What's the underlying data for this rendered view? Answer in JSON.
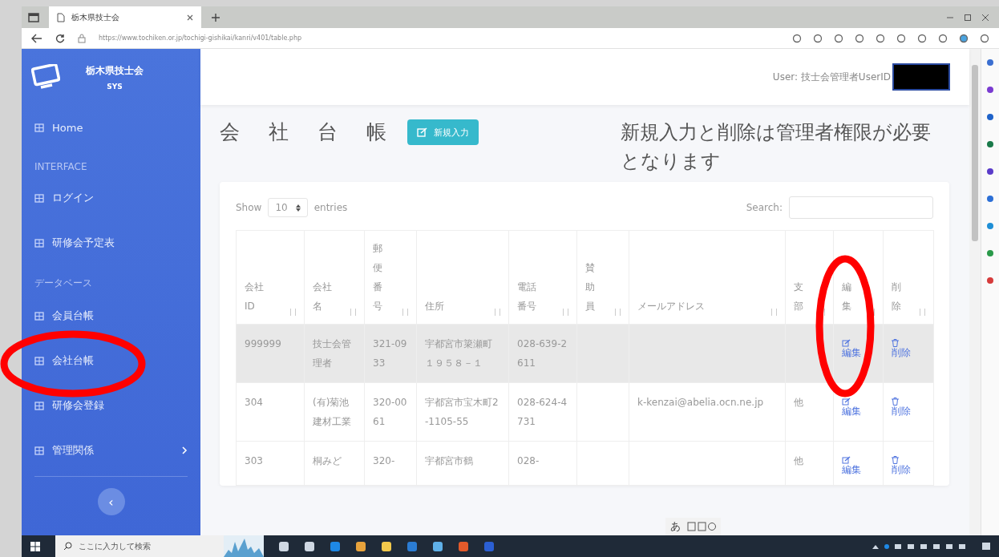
{
  "browser": {
    "tab_title": "栃木県技士会",
    "url": "https://www.tochiken.or.jp/tochigi-gishikai/kanri/v401/table.php"
  },
  "sidebar": {
    "brand": "栃木県技士会",
    "brand_sub": "SYS",
    "collapse_button": "‹",
    "items": [
      {
        "kind": "item",
        "label": "Home",
        "has_submenu": false
      },
      {
        "kind": "heading",
        "label": "INTERFACE"
      },
      {
        "kind": "item",
        "label": "ログイン",
        "has_submenu": false
      },
      {
        "kind": "item",
        "label": "研修会予定表",
        "has_submenu": false
      },
      {
        "kind": "heading",
        "label": "データベース"
      },
      {
        "kind": "item",
        "label": "会員台帳",
        "has_submenu": false
      },
      {
        "kind": "item",
        "label": "会社台帳",
        "has_submenu": false
      },
      {
        "kind": "item",
        "label": "研修会登録",
        "has_submenu": false
      },
      {
        "kind": "item",
        "label": "管理関係",
        "has_submenu": true
      }
    ]
  },
  "header": {
    "user_label": "User: 技士会管理者UserID"
  },
  "page": {
    "title": "会 社 台 帳",
    "new_button": "新規入力",
    "notice": "新規入力と削除は管理者権限が必要となります"
  },
  "table_controls": {
    "show": "Show",
    "page_size": "10",
    "entries": "entries",
    "search_label": "Search:"
  },
  "table": {
    "columns": [
      "会社ID",
      "会社名",
      "郵便番号",
      "住所",
      "電話番号",
      "賛助員",
      "メールアドレス",
      "支部",
      "編集",
      "削除"
    ],
    "rows": [
      {
        "highlighted": true,
        "cells": [
          "999999",
          "技士会管理者",
          "321-0933",
          "宇都宮市簗瀬町１９５８－１",
          "028-639-2611",
          "",
          "",
          ""
        ],
        "edit": "編集",
        "delete": "削除"
      },
      {
        "highlighted": false,
        "cells": [
          "304",
          "(有)菊池建材工業",
          "320-0061",
          "宇都宮市宝木町2-1105-55",
          "028-624-4731",
          "",
          "k-kenzai@abelia.ocn.ne.jp",
          "他"
        ],
        "edit": "編集",
        "delete": "削除"
      },
      {
        "highlighted": false,
        "cells": [
          "303",
          "桐みど",
          "320-",
          "宇都宮市鶴",
          "028-",
          "",
          "",
          "他"
        ],
        "edit": "編集",
        "delete": "削除"
      }
    ]
  },
  "ime_toolbar": {
    "mode": "あ"
  },
  "taskbar": {
    "search_placeholder": "ここに入力して検索"
  }
}
